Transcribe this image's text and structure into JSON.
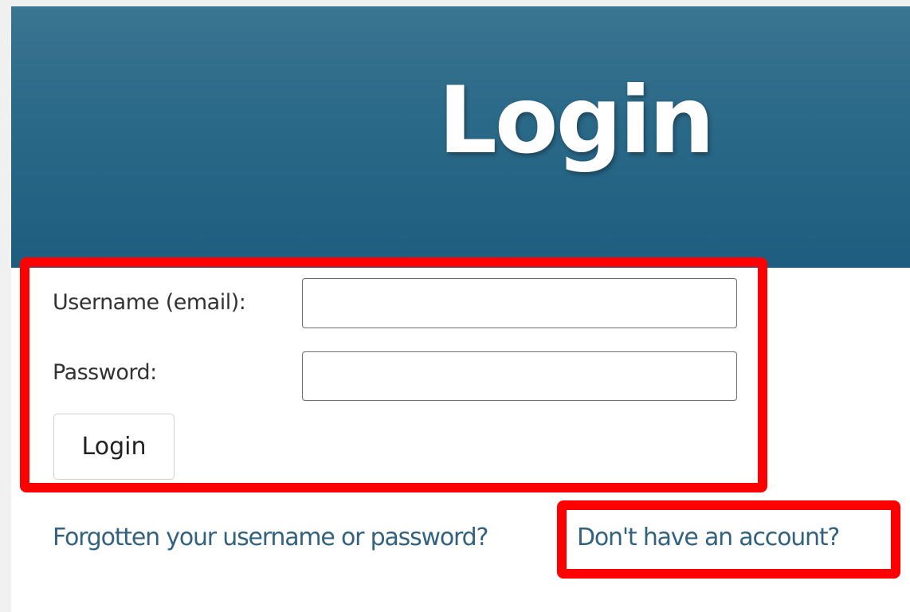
{
  "header": {
    "title": "Login"
  },
  "form": {
    "username_label": "Username (email):",
    "username_value": "",
    "password_label": "Password:",
    "password_value": "",
    "submit_label": "Login"
  },
  "links": {
    "forgot": "Forgotten your username or password?",
    "separator": "",
    "register": "Don't have an account?"
  },
  "colors": {
    "header_bg": "#2c6a89",
    "link": "#33627f",
    "highlight": "#ff0000"
  }
}
